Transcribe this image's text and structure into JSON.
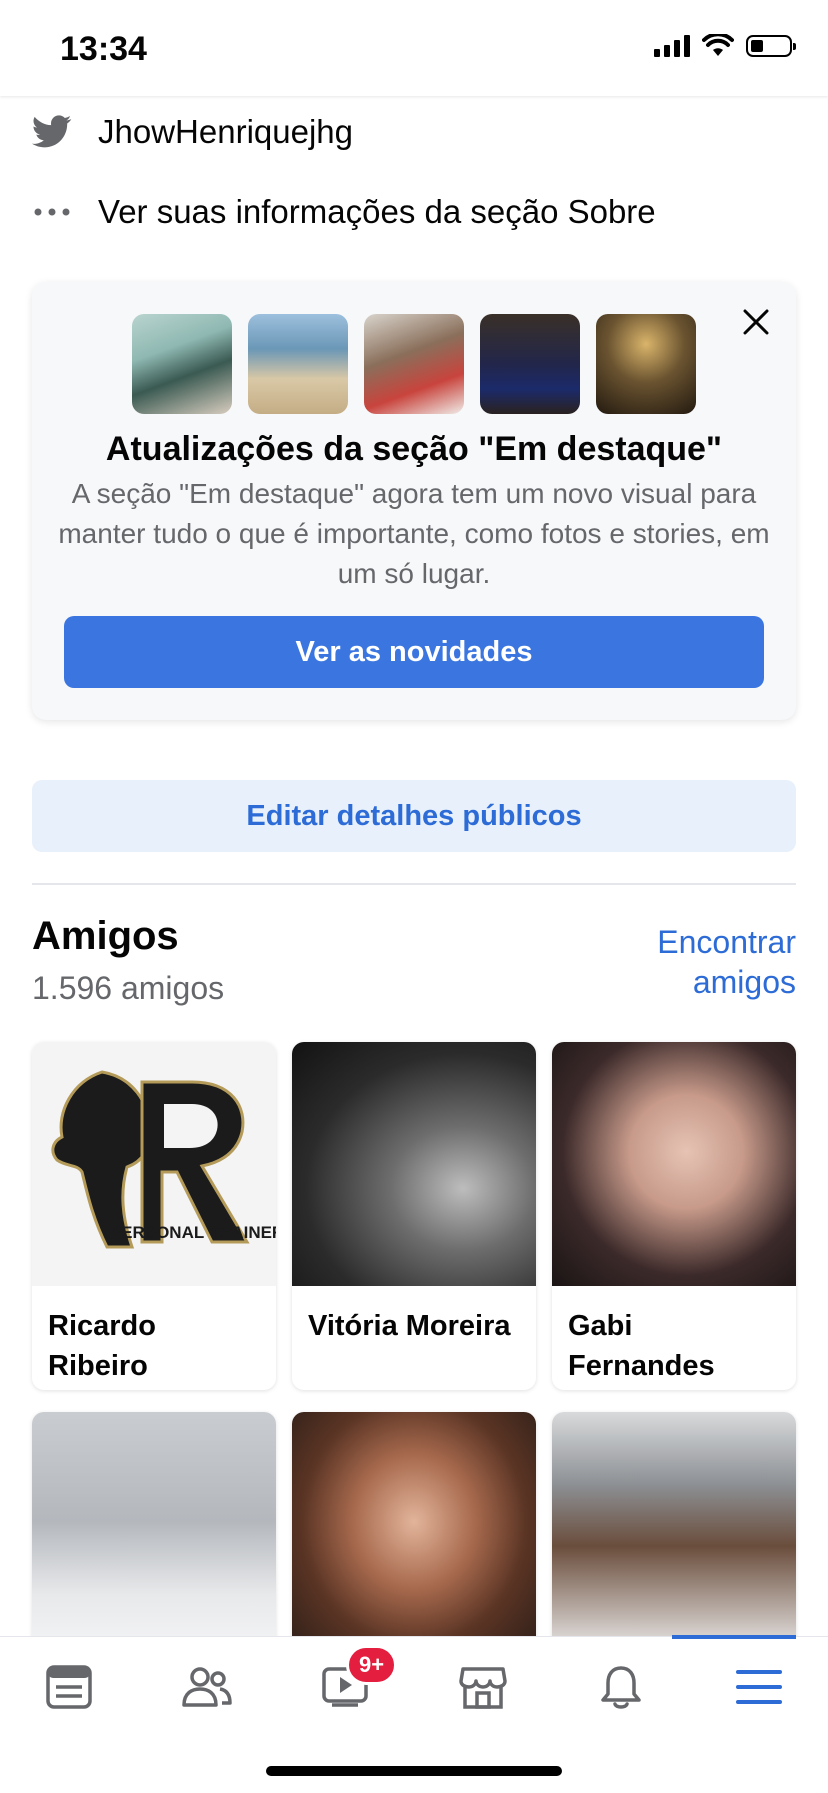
{
  "status_bar": {
    "time": "13:34"
  },
  "profile_info": {
    "twitter_handle": "JhowHenriquejhg",
    "about_link": "Ver suas informações da seção Sobre"
  },
  "highlights_card": {
    "title": "Atualizações da seção \"Em destaque\"",
    "description": "A seção \"Em destaque\" agora tem um novo visual para manter tudo o que é importante, como fotos e stories, em um só lugar.",
    "button_label": "Ver as novidades",
    "thumbnail_count": 5
  },
  "edit_public_details_label": "Editar detalhes públicos",
  "friends": {
    "title": "Amigos",
    "count": "1.596 amigos",
    "find_friends_label": "Encontrar amigos",
    "list": [
      {
        "name": "Ricardo Ribeiro",
        "logo_text": "PERSONAL TRAINER"
      },
      {
        "name": "Vitória Moreira"
      },
      {
        "name": "Gabi Fernandes"
      },
      {
        "name": ""
      },
      {
        "name": ""
      },
      {
        "name": ""
      }
    ]
  },
  "bottom_nav": {
    "tabs": [
      "news-feed",
      "friends",
      "watch",
      "marketplace",
      "notifications",
      "menu"
    ],
    "watch_badge": "9+",
    "active_tab": "menu"
  },
  "colors": {
    "accent": "#3b76e0",
    "link": "#2d6cd6",
    "badge": "#e41e3f",
    "secondary_text": "#65676b"
  }
}
